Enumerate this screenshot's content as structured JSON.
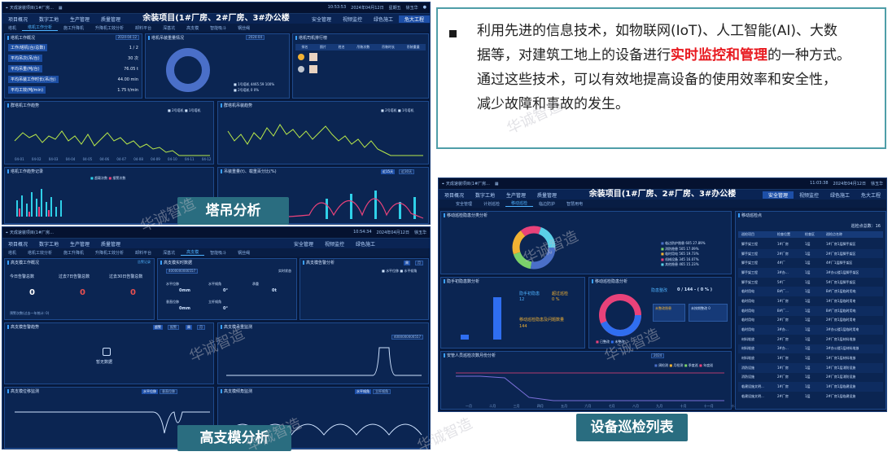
{
  "text_box": {
    "line1": "利用先进的信息技术，如物联网(IoT)、人工智能(AI)、大数",
    "line2a": "据等，对建筑工地上的设备进行",
    "line2_highlight": "实时监控和管理",
    "line2b": "的一种方式。",
    "line3": "通过这些技术，可以有效地提高设备的使用效率和安全性，",
    "line4": "减少故障和事故的发生。"
  },
  "labels": {
    "crane": "塔吊分析",
    "formwork": "高支模分析",
    "inspection": "设备巡检列表"
  },
  "watermark": "华诚智造",
  "screen1": {
    "project_title": "余装项目(1#厂房、2#厂房、3#办公楼",
    "top_left": "天成速装项目(1#厂房...",
    "time": "10:53:53",
    "date": "2024年04月12日",
    "weekday": "星期五",
    "user": "徐玉华",
    "nav": [
      "项目概况",
      "数字工地",
      "生产管理",
      "质量管理",
      "安全管理",
      "视频监控",
      "绿色施工",
      "危大工程"
    ],
    "subnav": [
      "塔机",
      "塔机工作分析",
      "施工升降机",
      "升降机工效分析",
      "卸料平台",
      "深基坑",
      "高支模",
      "智能吸斗",
      "钢丝绳"
    ],
    "work_title": "塔机工作概况",
    "work_date": "2024-04-12",
    "work_rows": [
      {
        "k": "工作/塔机(台/总数)",
        "v": "1 / 2"
      },
      {
        "k": "平均吊次(吊/台)",
        "v": "30 次"
      },
      {
        "k": "平均吊重(吨/台)",
        "v": "76.05 t"
      },
      {
        "k": "平均吊装工作时长(吊/台)",
        "v": "44.00 min"
      },
      {
        "k": "平均工效(吨/min)",
        "v": "1.75 t/min"
      }
    ],
    "load_title": "塔机吊装重量情况",
    "load_date": "2024-04",
    "load_legend": [
      {
        "name": "1号塔机",
        "value": "4465.59",
        "pct": "100%"
      },
      {
        "name": "2号塔机",
        "value": "0",
        "pct": "0%"
      }
    ],
    "driver_title": "塔机司机排行榜",
    "driver_cols": [
      "排名",
      "照片",
      "姓名",
      "吊装次数",
      "吊装时长",
      "吊装重量"
    ],
    "trend1_title": "群塔机工作趋势",
    "trend1_legend": [
      "2号塔机",
      "1号塔机"
    ],
    "trend2_title": "群塔机吊装趋势",
    "trend2_legend": [
      "2号塔机",
      "1号塔机"
    ],
    "x_dates": [
      "04-01",
      "04-02",
      "04-03",
      "04-04",
      "04-05",
      "04-06",
      "04-07",
      "04-08",
      "04-09",
      "04-10",
      "04-11",
      "04-12"
    ],
    "bar_title": "塔机工作趋势记录",
    "bar_legend": [
      "超载次数",
      "报警次数"
    ],
    "wind_title": "吊装重量(t)、载重百分比(%)",
    "wind_tabs": [
      "近15天",
      "近30天"
    ]
  },
  "screen2": {
    "top_left": "天成速装项目(1#厂房...",
    "time": "10:54:34",
    "date": "2024年04月12日",
    "user": "徐玉华",
    "nav": [
      "项目概况",
      "数字工地",
      "生产管理",
      "质量管理",
      "安全管理",
      "视频监控",
      "绿色施工"
    ],
    "subnav": [
      "塔机",
      "塔机工效分析",
      "施工升降机",
      "升降机工效分析",
      "卸料平台",
      "深基坑",
      "高支模",
      "智能吸斗",
      "钢丝绳"
    ],
    "alarm_title": "高支模工作概况",
    "alarm_link": "告警记录",
    "counts": [
      {
        "label": "今日告警总数",
        "value": "0"
      },
      {
        "label": "过去7日告警总数",
        "value": "0"
      },
      {
        "label": "过去30日告警总数",
        "value": "0"
      }
    ],
    "footnote": "预警次数(过去一年统计: 0)",
    "realtime_title": "高支模实时数据",
    "device": "4000000000557",
    "status_label": "实时状态",
    "metrics": [
      {
        "label": "水平位移",
        "value": "0mm"
      },
      {
        "label": "水平倾角",
        "value": "0°"
      },
      {
        "label": "承重",
        "value": "0t"
      },
      {
        "label": "垂直位移",
        "value": "0mm"
      },
      {
        "label": "立杆倾角",
        "value": "0°"
      }
    ],
    "stats_title": "高支模告警分析",
    "stats_tabs": [
      "周",
      "月"
    ],
    "stats_legend": [
      "水平位移",
      "水平倾角"
    ],
    "trend_title": "高支模告警趋势",
    "trend_tabs": [
      "超警",
      "报警",
      "周",
      "月"
    ],
    "empty": "暂无数据",
    "monitor_title": "高支模承重监测",
    "monitor_device": "4000000000557",
    "offset_title": "高支模位移监测",
    "offset_tab": "水平位移",
    "offset_tab2": "垂直位移",
    "tilt_title": "高支模倾角监测",
    "tilt_tab": "水平倾角",
    "tilt_tab2": "立杆倾角"
  },
  "screen3": {
    "top_left": "天成速装项目(1#厂房...",
    "time": "11:03:38",
    "date": "2024年04月12日",
    "user": "徐玉华",
    "project_title": "余装项目(1#厂房、2#厂房、3#办公楼",
    "nav": [
      "项目概况",
      "数字工地",
      "生产管理",
      "质量管理",
      "安全管理",
      "视频监控",
      "绿色施工",
      "危大工程"
    ],
    "subnav": [
      "安全管理",
      "计划巡检",
      "移动巡检",
      "临边防护",
      "智慧用电"
    ],
    "pie_title": "移动巡检隐患分类分析",
    "pie_legend": [
      {
        "name": "临边防护隐患",
        "count": "605",
        "pct": "27.89%"
      },
      {
        "name": "消防隐患",
        "count": "505",
        "pct": "17.09%"
      },
      {
        "name": "临时用电",
        "count": "565",
        "pct": "19.73%"
      },
      {
        "name": "机械设备",
        "count": "345",
        "pct": "16.07%"
      },
      {
        "name": "其他隐患",
        "count": "465",
        "pct": "15.23%"
      }
    ],
    "bar_title": "隐手初隐患数分析",
    "bar_cats": [
      "隐手初数",
      "超过巡检"
    ],
    "kpi1_label": "隐手初隐患",
    "kpi1_value": "12",
    "kpi2_label": "超过巡检",
    "kpi2_value": "0 %",
    "kpi3_label": "移动巡检隐患及问题数量",
    "kpi3_value": "144",
    "ring_title": "移动巡检隐患分析",
    "ring_label": "隐患整改",
    "ring_value": "0 / 144 - ( 0 % )",
    "ring_box1": "未整改隐患",
    "ring_box2": "未按期整改",
    "ring_box2_value": "0",
    "ring_legend": [
      "已整改",
      "未整改"
    ],
    "line_title": "安管人员巡检次数月份分析",
    "line_date": "2024",
    "line_months": [
      "一月",
      "二月",
      "三月",
      "四月",
      "五月",
      "六月",
      "七月",
      "八月",
      "九月",
      "十月",
      "十一月",
      "十二月"
    ],
    "line_legend": [
      "周检测",
      "月检测",
      "季度巡",
      "年度巡"
    ],
    "list_title": "移动巡检点",
    "list_total_label": "巡检点总数：",
    "list_total": "16",
    "list_cols": [
      "巡检项目",
      "检查位置",
      "检查区",
      "巡检点名称"
    ],
    "list_rows": [
      [
        "脚手架工程",
        "1#厂房",
        "1层",
        "1#厂房1层脚手架区"
      ],
      [
        "脚手架工程",
        "2#厂房",
        "1层",
        "2#厂房1层脚手架区"
      ],
      [
        "脚手架工程",
        "4#厂",
        "1层",
        "4#厂1层脚手架区"
      ],
      [
        "脚手架工程",
        "3#办...",
        "1层",
        "3#办公楼1层脚手架区"
      ],
      [
        "脚手架工程",
        "5#厂",
        "1层",
        "5#厂房1层脚手架区"
      ],
      [
        "临时用电",
        "B#厂...",
        "1层",
        "B#厂房1层临时用电"
      ],
      [
        "临时用电",
        "1#厂房",
        "1层",
        "1#厂房1层临时用电"
      ],
      [
        "临时用电",
        "B#厂...",
        "1层",
        "B#厂房1层临时用电"
      ],
      [
        "临时用电",
        "2#厂房",
        "1层",
        "2#厂房1层临时用电"
      ],
      [
        "临时用电",
        "3#办...",
        "1层",
        "3#办公楼1层临时用电"
      ],
      [
        "材料堆放",
        "2#厂房",
        "1层",
        "2#厂房1层材料堆放"
      ],
      [
        "材料堆放",
        "3#办...",
        "1层",
        "3#办公楼1层材料堆放"
      ],
      [
        "材料堆放",
        "1#厂房",
        "1层",
        "1#厂房1层材料堆放"
      ],
      [
        "消防设施",
        "1#厂房",
        "1层",
        "1#厂房1层消防设施"
      ],
      [
        "消防设施",
        "2#厂房",
        "1层",
        "2#厂房1层消防设施"
      ],
      [
        "临建设施文明...",
        "1#厂房",
        "1层",
        "1#厂房1层临建设施"
      ],
      [
        "临建设施文明...",
        "2#厂房",
        "1层",
        "2#厂房1层临建设施"
      ]
    ]
  },
  "colors": {
    "accent": "#2a6d80",
    "highlight": "#e8191f",
    "dash_bg": "#07193c",
    "panel_bg": "#0b2552"
  }
}
